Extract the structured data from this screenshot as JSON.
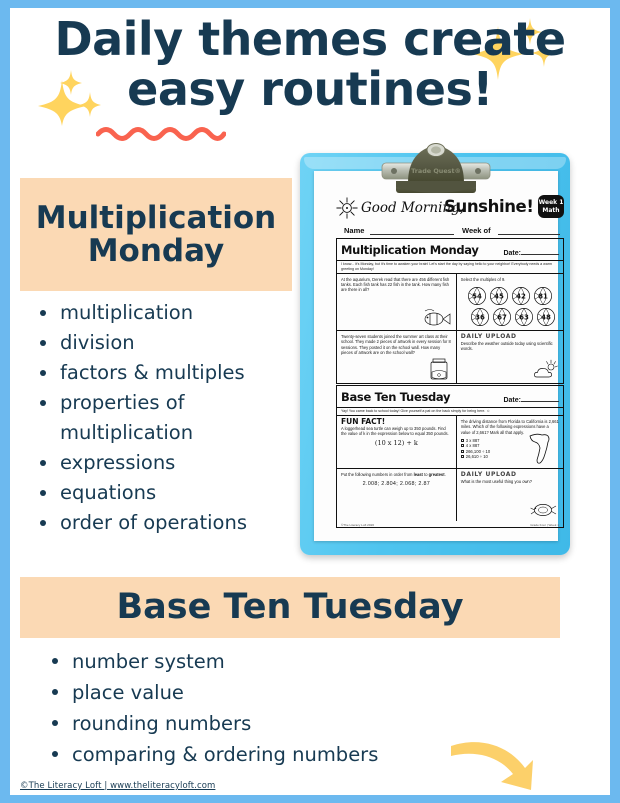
{
  "colors": {
    "border_blue": "#6cb9ef",
    "navy": "#173a52",
    "peach": "#fbd9b4",
    "coral": "#f9634f",
    "sparkle_yellow": "#ffd45e",
    "arrow_yellow": "#fcd06a",
    "clipboard_blue": "#4ec4ef"
  },
  "header": {
    "line1": "Daily themes create",
    "line2": "easy routines!",
    "sparkle_left": "sparkle-icon",
    "sparkle_right": "sparkle-icon",
    "underline": "wavy-underline"
  },
  "sections": [
    {
      "band_label": "Multiplication\nMonday",
      "band_line1": "Multiplication",
      "band_line2": "Monday",
      "bullets": [
        "multiplication",
        "division",
        "factors & multiples",
        "properties of",
        "multiplication",
        "expressions",
        "equations",
        "order of operations"
      ]
    },
    {
      "band_label": "Base Ten Tuesday",
      "bullets": [
        "number system",
        "place value",
        "rounding numbers",
        "comparing & ordering numbers"
      ]
    }
  ],
  "monday": {
    "band_line1": "Multiplication",
    "band_line2": "Monday",
    "bullets": [
      {
        "text": "multiplication",
        "continuation": false
      },
      {
        "text": "division",
        "continuation": false
      },
      {
        "text": "factors & multiples",
        "continuation": false
      },
      {
        "text": "properties of",
        "continuation": false
      },
      {
        "text": "multiplication",
        "continuation": true
      },
      {
        "text": "expressions",
        "continuation": false
      },
      {
        "text": "equations",
        "continuation": false
      },
      {
        "text": "order of operations",
        "continuation": false
      }
    ]
  },
  "tuesday": {
    "band_label": "Base Ten Tuesday",
    "bullets": [
      {
        "text": "number system",
        "continuation": false
      },
      {
        "text": "place value",
        "continuation": false
      },
      {
        "text": "rounding numbers",
        "continuation": false
      },
      {
        "text": "comparing & ordering numbers",
        "continuation": false
      }
    ]
  },
  "credit": "©The Literacy Loft | www.theliteracyloft.com",
  "arrow": "curved-arrow-icon",
  "clipboard": {
    "clip_brand": "Trade Quest®",
    "worksheet": {
      "greeting_script": "Good Morning,",
      "greeting_bold": "Sunshine!",
      "badge_line1": "Week 1",
      "badge_line2": "Math",
      "name_label": "Name",
      "week_label": "Week of",
      "monday": {
        "title": "Multiplication Monday",
        "date_label": "Date:",
        "subtitle": "I know... it's Monday, but it's time to awaken your brain! Let's start the day by saying hello to your neighbor! Everybody needs a warm greeting on Monday!",
        "q1": "At the aquarium, Derek read that there are 456 different fish tanks. Each fish tank has 22 fish in the tank. How many fish are there in all?",
        "q2_prompt": "Select the multiples of 9.",
        "balls_row1": [
          "54",
          "45",
          "42",
          "81"
        ],
        "balls_row2": [
          "36",
          "67",
          "63",
          "48"
        ],
        "q3": "Twenty-seven students joined the summer art class at their school. They made 2 pieces of artwork in every session for 8 sessions. They posted it on the school wall. How many pieces of artwork are on the school wall?",
        "daily_upload_label": "DAILY UPLOAD",
        "daily_upload_prompt": "Describe the weather outside today using scientific words."
      },
      "tuesday": {
        "title": "Base Ten Tuesday",
        "date_label": "Date:",
        "subtitle": "Yay! You came back to school today! Give yourself a pat on the back simply for being here. ☺",
        "fun_fact_label": "FUN FACT!",
        "fun_fact_text": "A loggerhead sea turtle can weigh up to 350 pounds. Find the value of k in the expression below to equal 350 pounds.",
        "expression": "(10 x 12) + k",
        "q_right": "The driving distance from Florida to California is 2,661 miles. Which of the following expressions have a value of 2,661? Mark all that apply.",
        "choices": [
          "3 x 887",
          "4 x 887",
          "266,100 ÷ 10",
          "26,610 ÷ 10"
        ],
        "order_prompt_a": "Put the following numbers in order from ",
        "order_prompt_bold1": "least",
        "order_prompt_b": " to ",
        "order_prompt_bold2": "greatest",
        "order_prompt_c": ".",
        "numbers": "2.008;  2.804;  2.068;  2.87",
        "daily_upload_label": "DAILY UPLOAD",
        "daily_upload_prompt": "What is the most useful thing you own?",
        "footer_left": "©The Literacy Loft 2020",
        "footer_right": "Grade Four | Week 1"
      }
    }
  }
}
